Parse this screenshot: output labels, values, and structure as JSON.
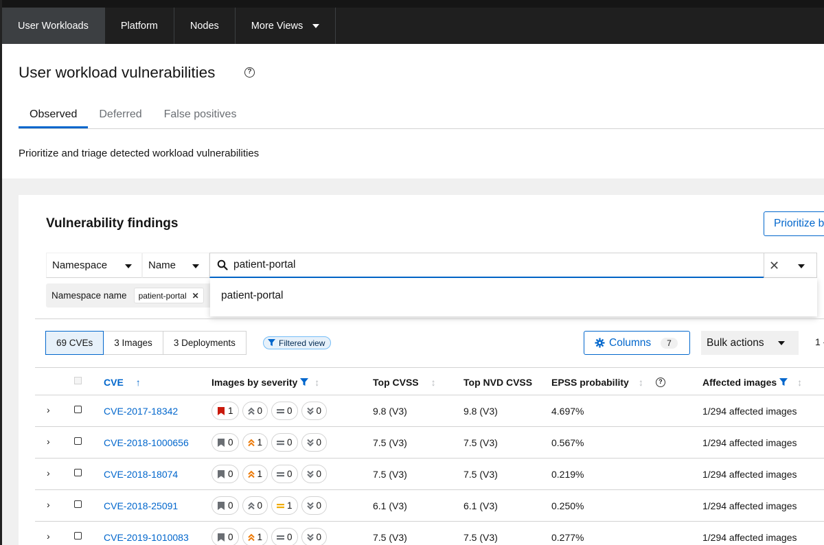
{
  "nav": {
    "tabs": [
      "User Workloads",
      "Platform",
      "Nodes",
      "More Views"
    ]
  },
  "page": {
    "title": "User workload vulnerabilities",
    "tabs": [
      "Observed",
      "Deferred",
      "False positives"
    ],
    "description": "Prioritize and triage detected workload vulnerabilities"
  },
  "card": {
    "title": "Vulnerability findings",
    "prioritize_button": "Prioritize b",
    "filter": {
      "entity_select": "Namespace",
      "attribute_select": "Name",
      "search_value": "patient-portal",
      "dropdown_option": "patient-portal",
      "chip_group_label": "Namespace name",
      "chip_value": "patient-portal"
    },
    "toggle": [
      "69 CVEs",
      "3 Images",
      "3 Deployments"
    ],
    "filtered_badge": "Filtered view",
    "columns_button": "Columns",
    "columns_count": "7",
    "bulk_actions": "Bulk actions",
    "pagination": "1 -"
  },
  "table": {
    "headers": {
      "cve": "CVE",
      "images_by_severity": "Images by severity",
      "top_cvss": "Top CVSS",
      "top_nvd_cvss": "Top NVD CVSS",
      "epss": "EPSS probability",
      "affected_images": "Affected images"
    },
    "rows": [
      {
        "cve": "CVE-2017-18342",
        "critical": "1",
        "important": "0",
        "moderate": "0",
        "low": "0",
        "cvss": "9.8 (V3)",
        "nvd": "9.8 (V3)",
        "epss": "4.697%",
        "affected": "1/294 affected images"
      },
      {
        "cve": "CVE-2018-1000656",
        "critical": "0",
        "important": "1",
        "moderate": "0",
        "low": "0",
        "cvss": "7.5 (V3)",
        "nvd": "7.5 (V3)",
        "epss": "0.567%",
        "affected": "1/294 affected images"
      },
      {
        "cve": "CVE-2018-18074",
        "critical": "0",
        "important": "1",
        "moderate": "0",
        "low": "0",
        "cvss": "7.5 (V3)",
        "nvd": "7.5 (V3)",
        "epss": "0.219%",
        "affected": "1/294 affected images"
      },
      {
        "cve": "CVE-2018-25091",
        "critical": "0",
        "important": "0",
        "moderate": "1",
        "low": "0",
        "cvss": "6.1 (V3)",
        "nvd": "6.1 (V3)",
        "epss": "0.250%",
        "affected": "1/294 affected images"
      },
      {
        "cve": "CVE-2019-1010083",
        "critical": "0",
        "important": "1",
        "moderate": "0",
        "low": "0",
        "cvss": "7.5 (V3)",
        "nvd": "7.5 (V3)",
        "epss": "0.277%",
        "affected": "1/294 affected images"
      }
    ]
  },
  "colors": {
    "accent": "#0066cc",
    "critical": "#c9190b",
    "important": "#ec7a08",
    "moderate": "#f0ab00",
    "inactive": "#6a6e73"
  }
}
